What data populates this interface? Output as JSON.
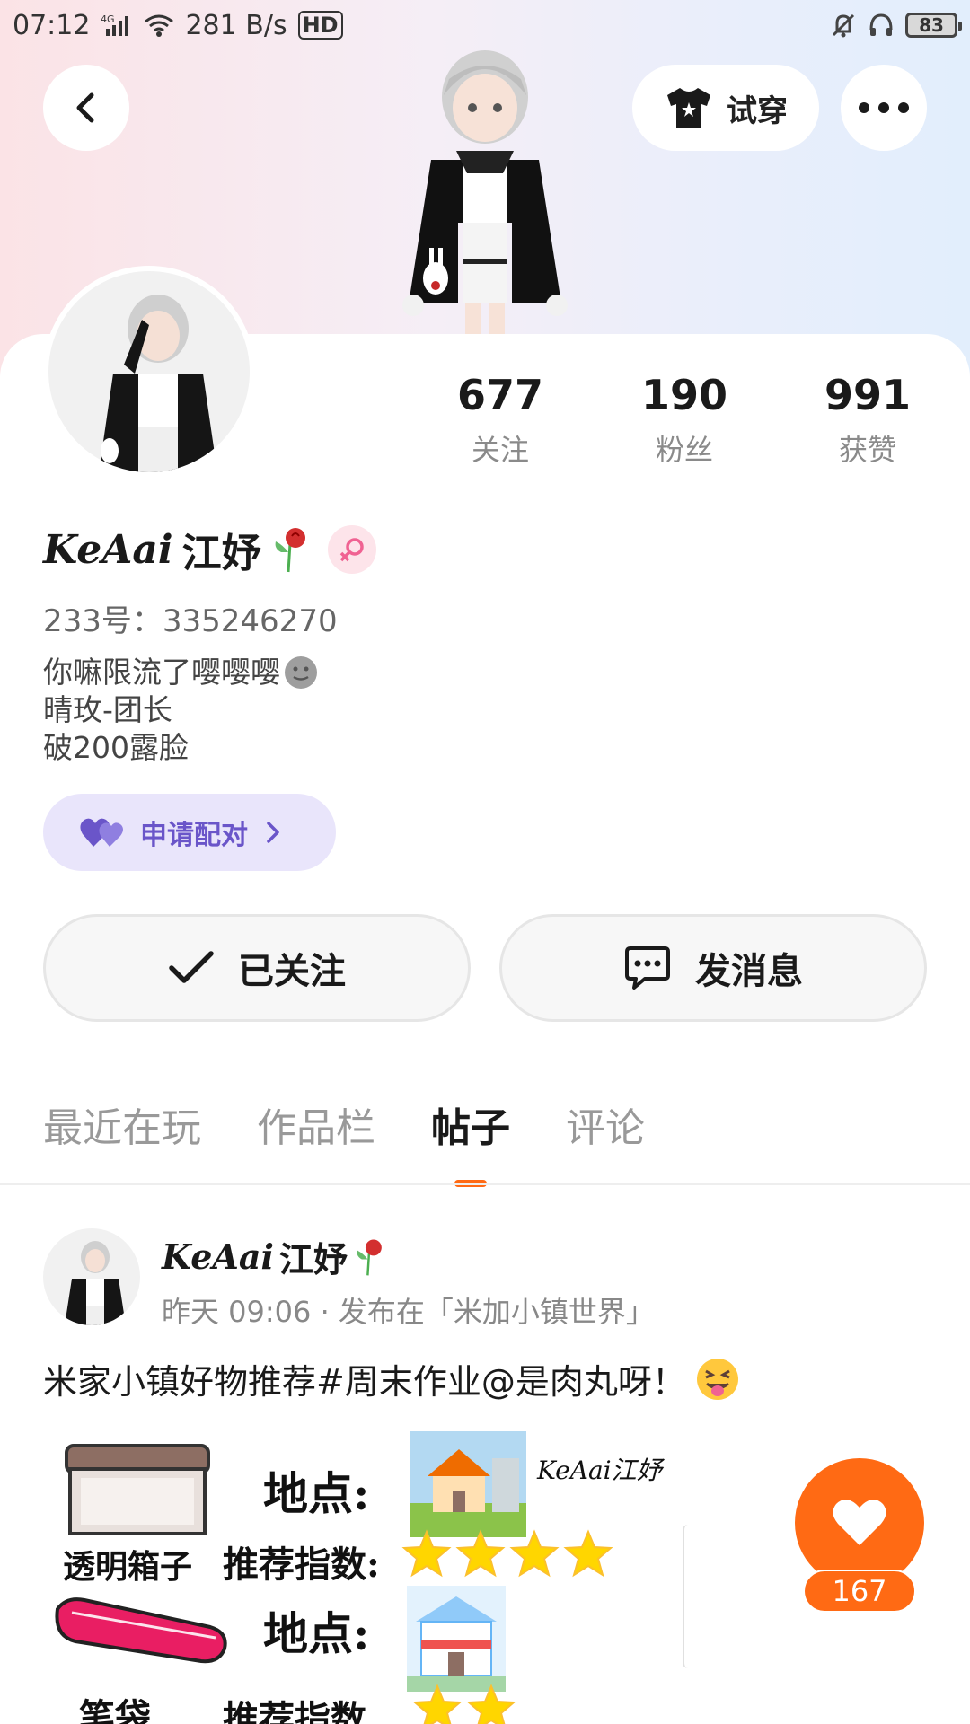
{
  "status_bar": {
    "time": "07:12",
    "network": "4G",
    "speed": "281 B/s",
    "hd": "HD",
    "battery": "83"
  },
  "header": {
    "tryon_label": "试穿"
  },
  "profile": {
    "stats": [
      {
        "value": "677",
        "label": "关注"
      },
      {
        "value": "190",
        "label": "粉丝"
      },
      {
        "value": "991",
        "label": "获赞"
      }
    ],
    "nickname_script": "KeAai",
    "nickname": "江妤",
    "uid": "233号：335246270",
    "bio_lines": [
      "你嘛限流了嘤嘤嘤",
      "晴玫-团长",
      "破200露脸"
    ],
    "pair_label": "申请配对",
    "followed_label": "已关注",
    "message_label": "发消息"
  },
  "tabs": [
    {
      "label": "最近在玩",
      "active": false
    },
    {
      "label": "作品栏",
      "active": false
    },
    {
      "label": "帖子",
      "active": true
    },
    {
      "label": "评论",
      "active": false
    }
  ],
  "post": {
    "author_script": "KeAai",
    "author": "江妤",
    "meta": "昨天 09:06 · 发布在「米加小镇世界」",
    "text": "米家小镇好物推荐#周末作业@是肉丸呀！",
    "image": {
      "watermark": "KeAai江妤",
      "row1_location": "地点:",
      "row1_item": "透明箱子",
      "row1_rating_label": "推荐指数:",
      "row2_location": "地点:",
      "row2_item": "笔袋",
      "row2_rating_label": "推荐指数"
    }
  },
  "like": {
    "count": "167"
  },
  "colors": {
    "accent_orange": "#ff6a14",
    "pair_purple": "#6a55c9",
    "pair_bg": "#e9e5fb"
  }
}
